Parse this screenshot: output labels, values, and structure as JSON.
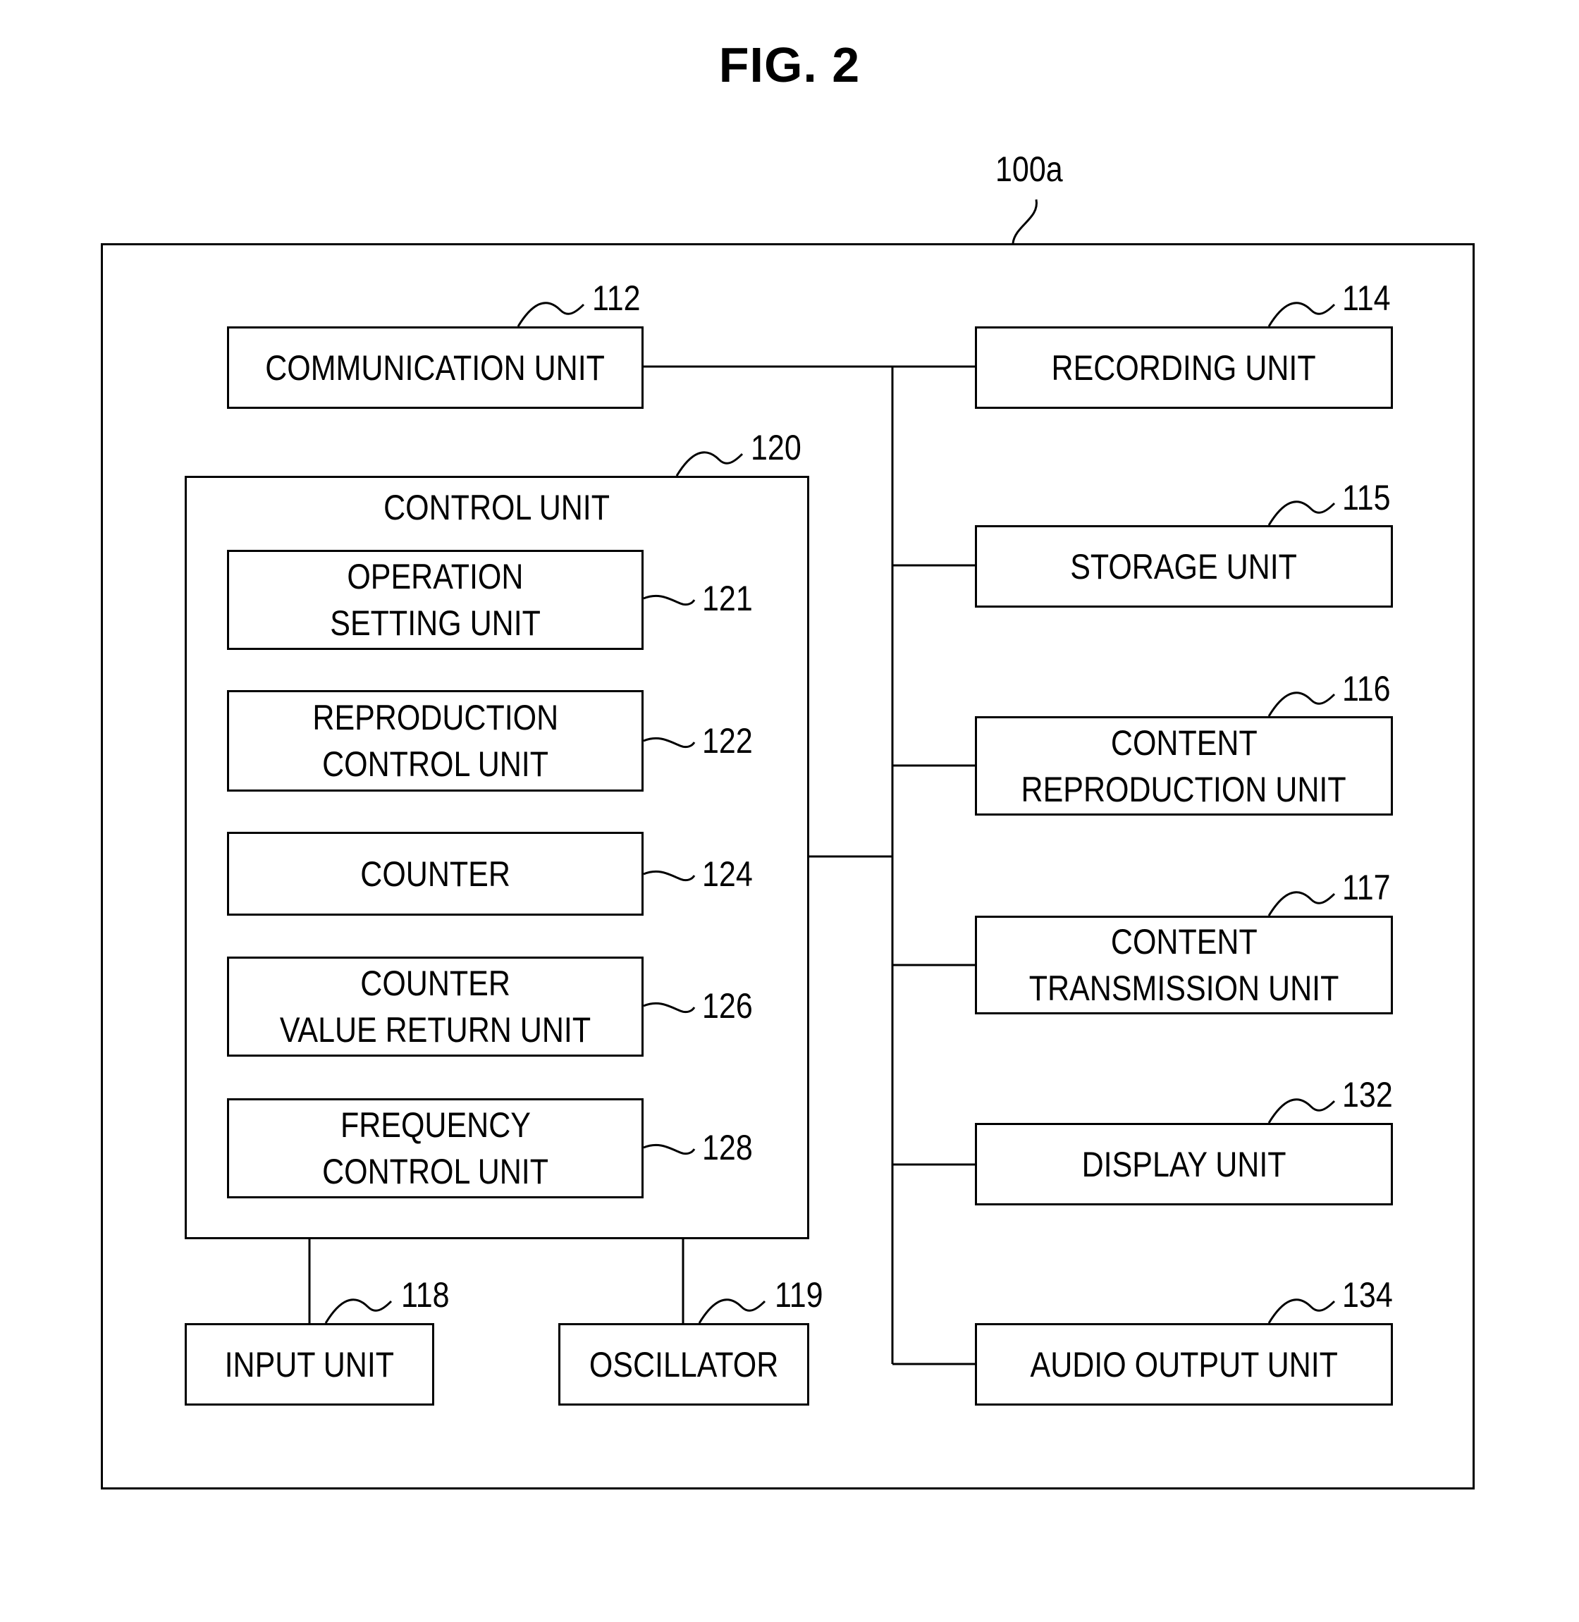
{
  "figure": {
    "title": "FIG. 2",
    "device_ref": "100a"
  },
  "units": {
    "communication": {
      "label": [
        "COMMUNICATION UNIT"
      ],
      "ref": "112"
    },
    "recording": {
      "label": [
        "RECORDING UNIT"
      ],
      "ref": "114"
    },
    "storage": {
      "label": [
        "STORAGE UNIT"
      ],
      "ref": "115"
    },
    "content_reproduction": {
      "label": [
        "CONTENT",
        "REPRODUCTION UNIT"
      ],
      "ref": "116"
    },
    "content_transmission": {
      "label": [
        "CONTENT",
        "TRANSMISSION UNIT"
      ],
      "ref": "117"
    },
    "input": {
      "label": [
        "INPUT UNIT"
      ],
      "ref": "118"
    },
    "oscillator": {
      "label": [
        "OSCILLATOR"
      ],
      "ref": "119"
    },
    "display": {
      "label": [
        "DISPLAY UNIT"
      ],
      "ref": "132"
    },
    "audio_output": {
      "label": [
        "AUDIO OUTPUT UNIT"
      ],
      "ref": "134"
    }
  },
  "control_unit": {
    "title": "CONTROL UNIT",
    "ref": "120",
    "subunits": {
      "operation_setting": {
        "label": [
          "OPERATION",
          "SETTING UNIT"
        ],
        "ref": "121"
      },
      "reproduction_control": {
        "label": [
          "REPRODUCTION",
          "CONTROL UNIT"
        ],
        "ref": "122"
      },
      "counter": {
        "label": [
          "COUNTER"
        ],
        "ref": "124"
      },
      "counter_value_return": {
        "label": [
          "COUNTER",
          "VALUE RETURN UNIT"
        ],
        "ref": "126"
      },
      "frequency_control": {
        "label": [
          "FREQUENCY",
          "CONTROL UNIT"
        ],
        "ref": "128"
      }
    }
  }
}
